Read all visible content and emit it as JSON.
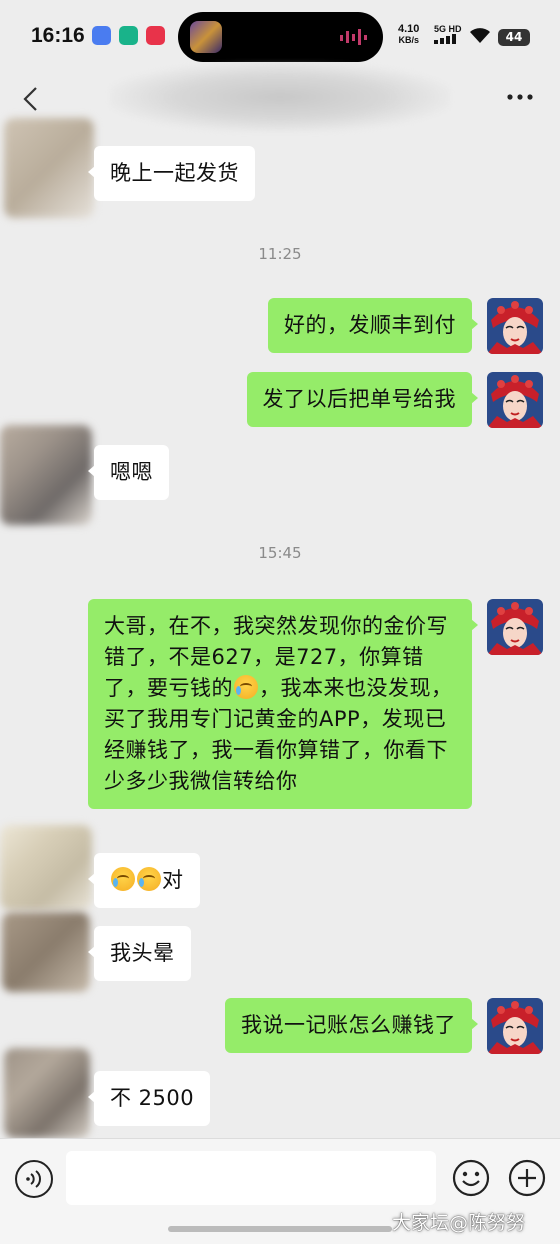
{
  "status_bar": {
    "time": "16:16",
    "speed_value": "4.10",
    "speed_unit": "KB/s",
    "network": "5G HD",
    "battery": "44"
  },
  "header": {
    "back_icon": "chevron-left-icon",
    "more_icon": "more-dots-icon"
  },
  "timestamps": [
    "11:25",
    "15:45"
  ],
  "messages": [
    {
      "side": "left",
      "text": "晚上一起发货"
    },
    {
      "side": "right",
      "text": "好的，发顺丰到付"
    },
    {
      "side": "right",
      "text": "发了以后把单号给我"
    },
    {
      "side": "left",
      "text": "嗯嗯"
    },
    {
      "side": "right",
      "text_1": "大哥，在不，我突然发现你的金价写错了，不是627，是727，你算错了，要亏钱的",
      "text_2": "，我本来也没发现，买了我用专门记黄金的APP，发现已经赚钱了，我一看你算错了，你看下少多少我微信转给你"
    },
    {
      "side": "left",
      "text": "对"
    },
    {
      "side": "left",
      "text": "我头晕"
    },
    {
      "side": "right",
      "text": "我说一记账怎么赚钱了"
    },
    {
      "side": "left",
      "text": "不 2500"
    }
  ],
  "input_bar": {
    "placeholder": "",
    "voice_icon": "voice-icon",
    "emoji_icon": "emoji-icon",
    "plus_icon": "plus-icon"
  },
  "watermark": "大家坛@陈努努",
  "colors": {
    "background": "#ededed",
    "bubble_self": "#95ec69",
    "bubble_other": "#ffffff"
  }
}
